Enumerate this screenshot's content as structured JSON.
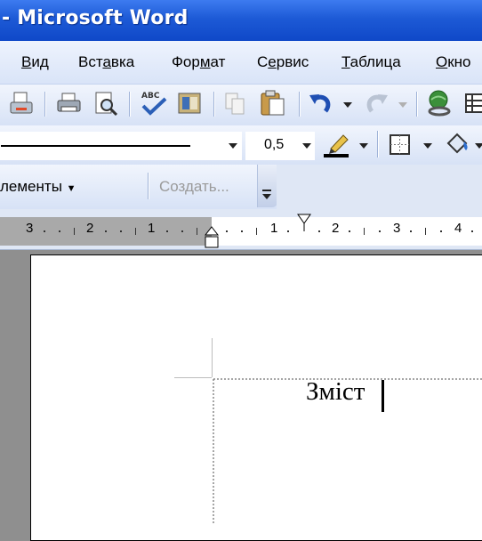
{
  "window": {
    "title": "- Microsoft Word"
  },
  "menu": [
    {
      "label": "Вид",
      "accel_index": 0
    },
    {
      "label": "Вставка",
      "accel_index": 3
    },
    {
      "label": "Формат",
      "accel_index": 3
    },
    {
      "label": "Сервис",
      "accel_index": 1
    },
    {
      "label": "Таблица",
      "accel_index": 0
    },
    {
      "label": "Окно",
      "accel_index": 0
    }
  ],
  "toolbar_standard": {
    "icons": [
      "permission-icon",
      "print-icon",
      "print-preview-icon",
      "spelling-icon",
      "research-icon",
      "copy-icon",
      "paste-icon",
      "undo-icon",
      "redo-icon",
      "hyperlink-icon",
      "table-icon"
    ]
  },
  "toolbar_tables": {
    "line_style": "solid",
    "line_weight": "0,5",
    "icons": [
      "pen-color-icon",
      "border-icon",
      "fill-color-icon"
    ],
    "pen_color": "#000000"
  },
  "toolbar_forms": {
    "elements_label": "лементы",
    "create_label": "Создать...",
    "create_enabled": false
  },
  "ruler": {
    "left_labels": [
      "3",
      "2",
      "1"
    ],
    "right_labels": [
      "1",
      "2",
      "3",
      "4"
    ]
  },
  "document": {
    "heading": "Зміст"
  },
  "colors": {
    "title_bar": "#1d5ad6",
    "accent": "#3d7bf0",
    "disabled_text": "#9a9a9a"
  }
}
